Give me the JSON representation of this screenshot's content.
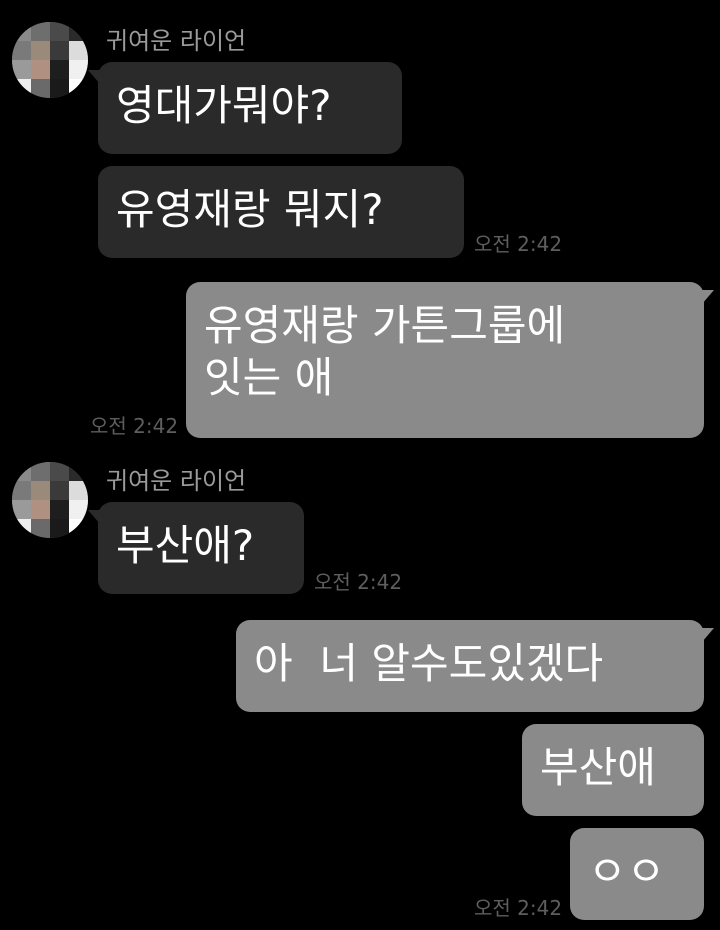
{
  "chat": {
    "sender_name": "귀여운 라이언",
    "messages": [
      {
        "from": "incoming",
        "text": "영대가뭐야?"
      },
      {
        "from": "incoming",
        "text": "유영재랑 뭐지?",
        "time": "오전 2:42"
      },
      {
        "from": "outgoing",
        "text": "유영재랑 가튼그룹에\n잇는 애",
        "time": "오전 2:42"
      },
      {
        "from": "incoming",
        "text": "부산애?",
        "time": "오전 2:42"
      },
      {
        "from": "outgoing",
        "text": "아  너 알수도있겠다"
      },
      {
        "from": "outgoing",
        "text": "부산애"
      },
      {
        "from": "outgoing",
        "text": "ㅇㅇ",
        "time": "오전 2:42"
      }
    ]
  },
  "colors": {
    "background": "#000000",
    "incoming_bubble": "#2a2a2a",
    "outgoing_bubble": "#8a8a8a",
    "timestamp": "#5e5e5e",
    "sender_name": "#9a9a9a"
  },
  "icons": {
    "avatar": "pixelated-profile-avatar-icon"
  }
}
